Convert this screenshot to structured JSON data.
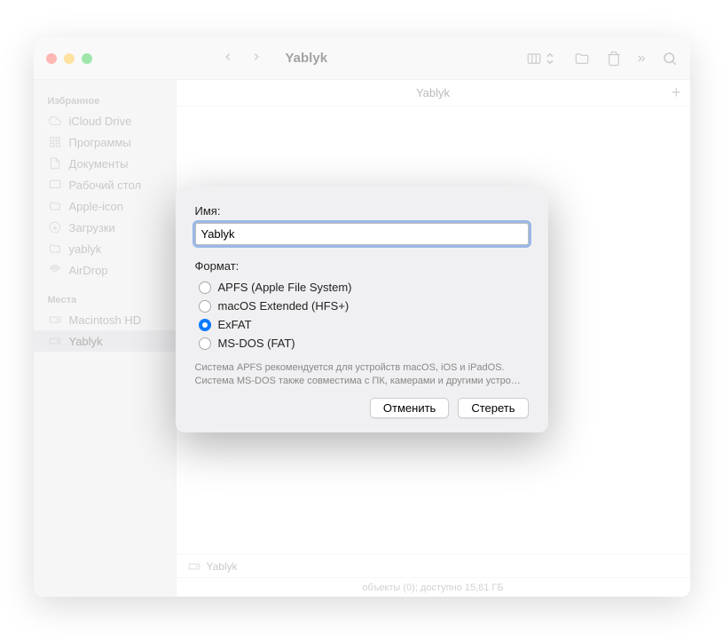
{
  "window": {
    "title": "Yablyk"
  },
  "sidebar": {
    "section_favorites": "Избранное",
    "section_places": "Места",
    "favorites": [
      {
        "label": "iCloud Drive",
        "icon": "cloud"
      },
      {
        "label": "Программы",
        "icon": "apps"
      },
      {
        "label": "Документы",
        "icon": "doc"
      },
      {
        "label": "Рабочий стол",
        "icon": "desktop"
      },
      {
        "label": "Apple-icon",
        "icon": "folder"
      },
      {
        "label": "Загрузки",
        "icon": "down"
      },
      {
        "label": "yablyk",
        "icon": "folder"
      },
      {
        "label": "AirDrop",
        "icon": "airdrop"
      }
    ],
    "places": [
      {
        "label": "Macintosh HD",
        "icon": "disk",
        "selected": false
      },
      {
        "label": "Yablyk",
        "icon": "disk",
        "selected": true
      }
    ]
  },
  "content": {
    "path_current": "Yablyk",
    "watermark": "Yablyk",
    "footer_device": "Yablyk",
    "footer_status": "объекты (0); доступно 15,81 ГБ"
  },
  "dialog": {
    "name_label": "Имя:",
    "name_value": "Yablyk",
    "format_label": "Формат:",
    "formats": [
      {
        "label": "APFS (Apple File System)",
        "checked": false
      },
      {
        "label": "macOS Extended (HFS+)",
        "checked": false
      },
      {
        "label": "ExFAT",
        "checked": true
      },
      {
        "label": "MS-DOS (FAT)",
        "checked": false
      }
    ],
    "info": "Система APFS рекомендуется для устройств macOS, iOS и iPadOS. Система MS-DOS также совместима с ПК, камерами и другими устро…",
    "cancel": "Отменить",
    "erase": "Стереть"
  }
}
